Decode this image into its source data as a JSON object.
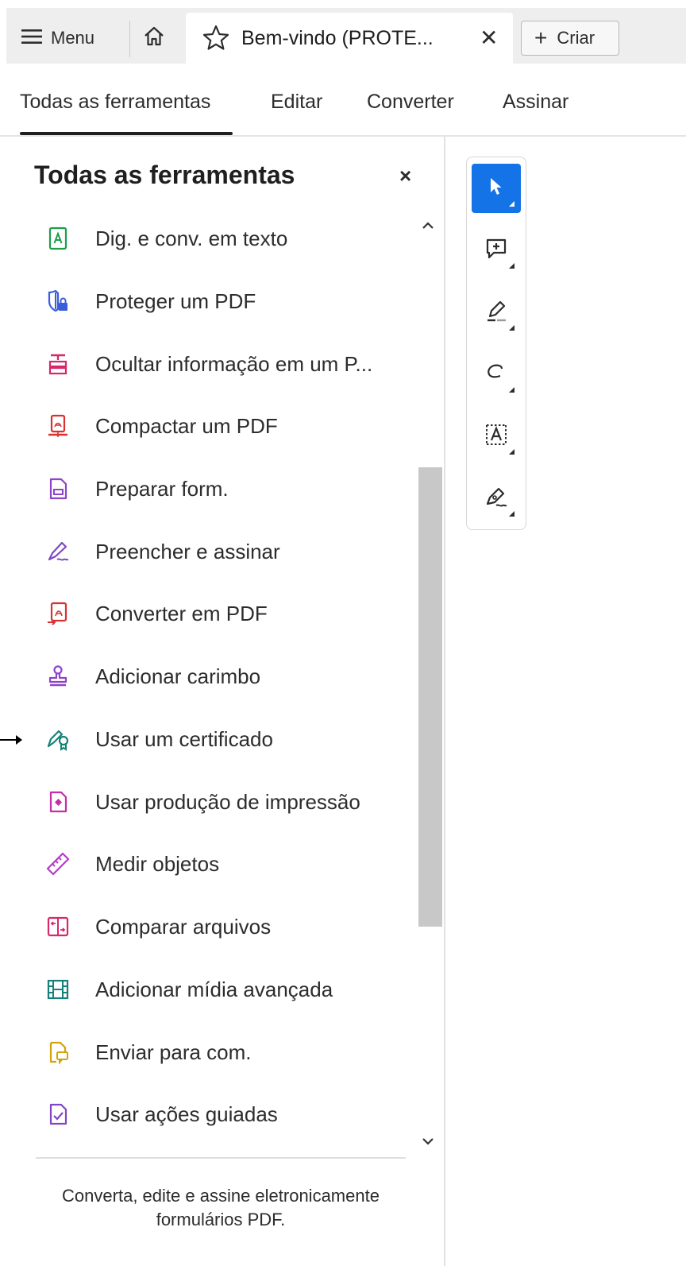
{
  "tabbar": {
    "menu_label": "Menu",
    "doc_tab_title": "Bem-vindo (PROTE...",
    "doc_tab_close": "✕",
    "create_label": "Criar",
    "create_plus": "+"
  },
  "secnav": {
    "items": [
      {
        "label": "Todas as ferramentas",
        "active": true
      },
      {
        "label": "Editar",
        "active": false
      },
      {
        "label": "Converter",
        "active": false
      },
      {
        "label": "Assinar",
        "active": false
      }
    ]
  },
  "panel": {
    "title": "Todas as ferramentas",
    "close": "×",
    "tools": [
      {
        "label": "Dig. e conv. em texto",
        "icon": "scan-ocr-icon",
        "color": "#1e9e4b"
      },
      {
        "label": "Proteger um PDF",
        "icon": "protect-shield-icon",
        "color": "#3a5ddb"
      },
      {
        "label": "Ocultar informação em um P...",
        "icon": "redact-icon",
        "color": "#d6286b"
      },
      {
        "label": "Compactar um PDF",
        "icon": "compress-pdf-icon",
        "color": "#d73232"
      },
      {
        "label": "Preparar form.",
        "icon": "prepare-form-icon",
        "color": "#8e44c9"
      },
      {
        "label": "Preencher e assinar",
        "icon": "fill-sign-icon",
        "color": "#7f47c6"
      },
      {
        "label": "Converter em PDF",
        "icon": "create-pdf-icon",
        "color": "#d73232"
      },
      {
        "label": "Adicionar carimbo",
        "icon": "stamp-icon",
        "color": "#8e44c9"
      },
      {
        "label": "Usar um certificado",
        "icon": "certificate-icon",
        "color": "#16817a"
      },
      {
        "label": "Usar produção de impressão",
        "icon": "print-production-icon",
        "color": "#c42ea8"
      },
      {
        "label": "Medir objetos",
        "icon": "measure-ruler-icon",
        "color": "#b33dc6"
      },
      {
        "label": "Comparar arquivos",
        "icon": "compare-files-icon",
        "color": "#d6286b"
      },
      {
        "label": "Adicionar mídia avançada",
        "icon": "rich-media-icon",
        "color": "#16817a"
      },
      {
        "label": "Enviar para com.",
        "icon": "send-comments-icon",
        "color": "#d3a30c"
      },
      {
        "label": "Usar ações guiadas",
        "icon": "guided-actions-icon",
        "color": "#7f47c6"
      }
    ],
    "footer": "Converta, edite e assine eletronicamente formulários PDF."
  },
  "toolcolumn": {
    "buttons": [
      {
        "icon": "select-cursor-icon",
        "selected": true
      },
      {
        "icon": "add-comment-icon",
        "selected": false
      },
      {
        "icon": "highlight-pen-icon",
        "selected": false
      },
      {
        "icon": "draw-freeform-icon",
        "selected": false
      },
      {
        "icon": "text-recognition-icon",
        "selected": false
      },
      {
        "icon": "sign-pen-icon",
        "selected": false
      }
    ]
  },
  "colors": {
    "accent": "#1473e6",
    "tab_strip": "#eeeeee",
    "scroll_thumb": "#c8c8c8"
  }
}
